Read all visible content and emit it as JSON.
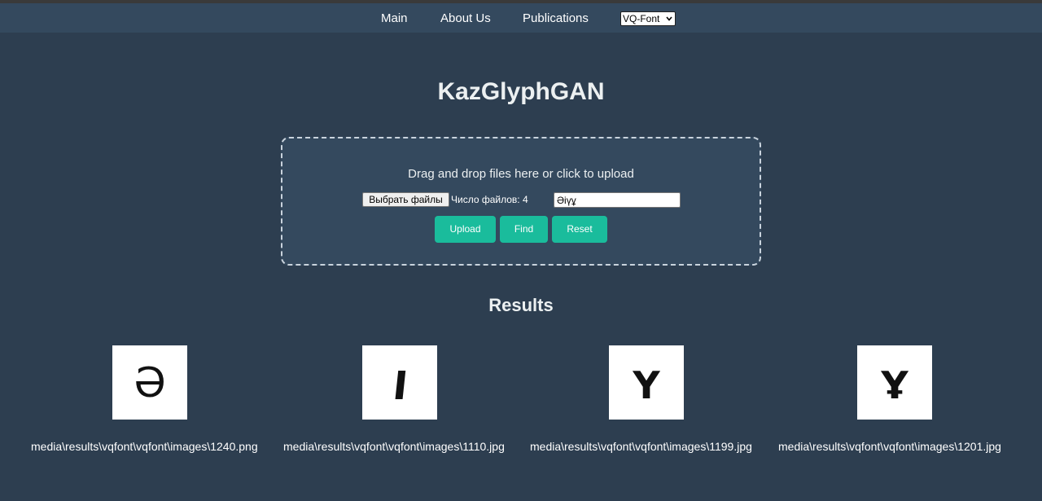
{
  "nav": {
    "links": [
      "Main",
      "About Us",
      "Publications"
    ],
    "select_value": "VQ-Font"
  },
  "page_title": "KazGlyphGAN",
  "upload": {
    "hint": "Drag and drop files here or click to upload",
    "choose_files_label": "Выбрать файлы",
    "file_count_text": "Число файлов: 4",
    "text_value": "Әіүұ",
    "buttons": [
      "Upload",
      "Find",
      "Reset"
    ]
  },
  "results": {
    "title": "Results",
    "items": [
      {
        "glyph": "Ә",
        "caption": "media\\results\\vqfont\\vqfont\\images\\1240.png"
      },
      {
        "glyph": "І",
        "caption": "media\\results\\vqfont\\vqfont\\images\\1110.jpg"
      },
      {
        "glyph": "Ү",
        "caption": "media\\results\\vqfont\\vqfont\\images\\1199.jpg"
      },
      {
        "glyph": "Ұ",
        "caption": "media\\results\\vqfont\\vqfont\\images\\1201.jpg"
      }
    ]
  },
  "colors": {
    "background": "#2d3e50",
    "navbar": "#34495e",
    "accent": "#1abc9c"
  }
}
